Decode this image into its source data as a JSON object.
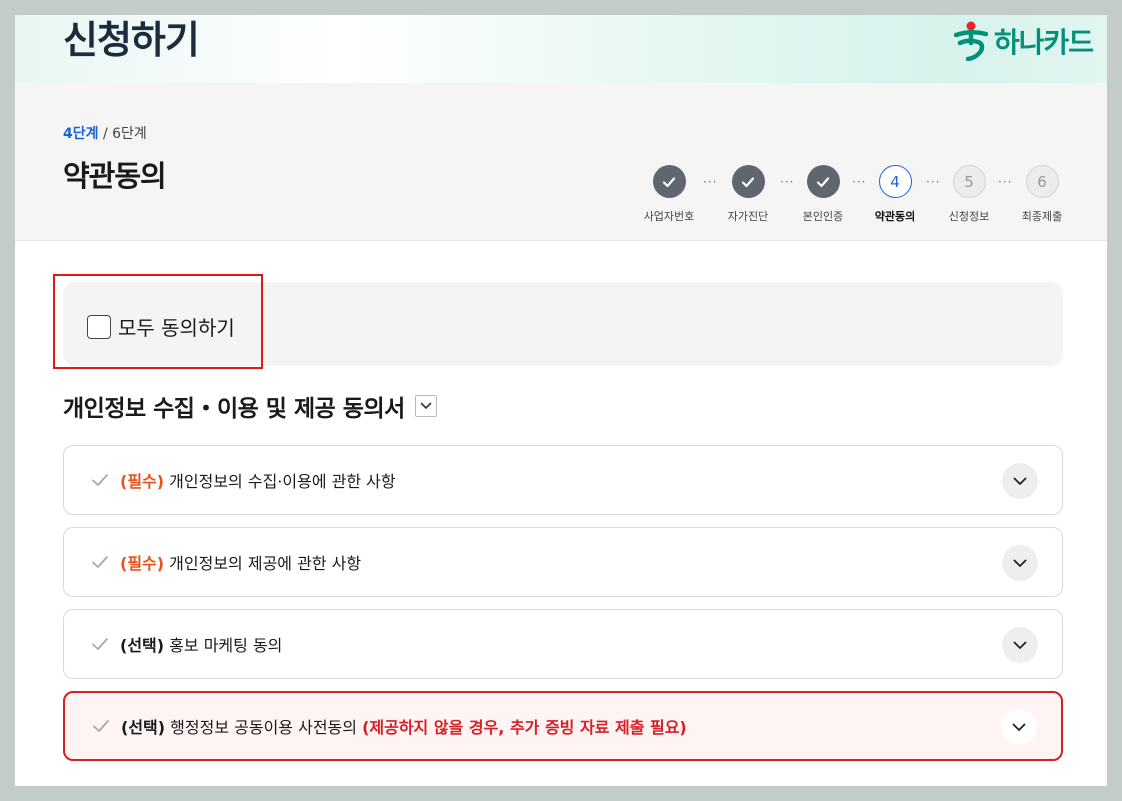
{
  "header": {
    "title": "신청하기",
    "brand_name": "하나카드"
  },
  "progress": {
    "current_label": "4단계",
    "separator": " / ",
    "total_label": "6단계",
    "heading": "약관동의",
    "steps": [
      {
        "number": "1",
        "label": "사업자번호",
        "status": "done"
      },
      {
        "number": "2",
        "label": "자가진단",
        "status": "done"
      },
      {
        "number": "3",
        "label": "본인인증",
        "status": "done"
      },
      {
        "number": "4",
        "label": "약관동의",
        "status": "current"
      },
      {
        "number": "5",
        "label": "신청정보",
        "status": "todo"
      },
      {
        "number": "6",
        "label": "최종제출",
        "status": "todo"
      }
    ],
    "separator_dots": "···"
  },
  "agree_all": {
    "label": "모두 동의하기",
    "checked": false
  },
  "section": {
    "title": "개인정보 수집・이용 및 제공 동의서"
  },
  "terms": [
    {
      "tag": "(필수)",
      "tag_type": "required",
      "text": "개인정보의 수집·이용에 관한 사항",
      "note": ""
    },
    {
      "tag": "(필수)",
      "tag_type": "required",
      "text": "개인정보의 제공에 관한 사항",
      "note": ""
    },
    {
      "tag": "(선택)",
      "tag_type": "optional",
      "text": "홍보 마케팅 동의",
      "note": ""
    },
    {
      "tag": "(선택)",
      "tag_type": "optional",
      "text": "행정정보 공동이용 사전동의",
      "note": "(제공하지 않을 경우, 추가 증빙 자료 제출 필요)"
    }
  ],
  "colors": {
    "brand": "#009178",
    "accent_blue": "#1e63d6",
    "required": "#e8541c",
    "warning": "#d61f26",
    "highlight_box": "#e01818"
  }
}
